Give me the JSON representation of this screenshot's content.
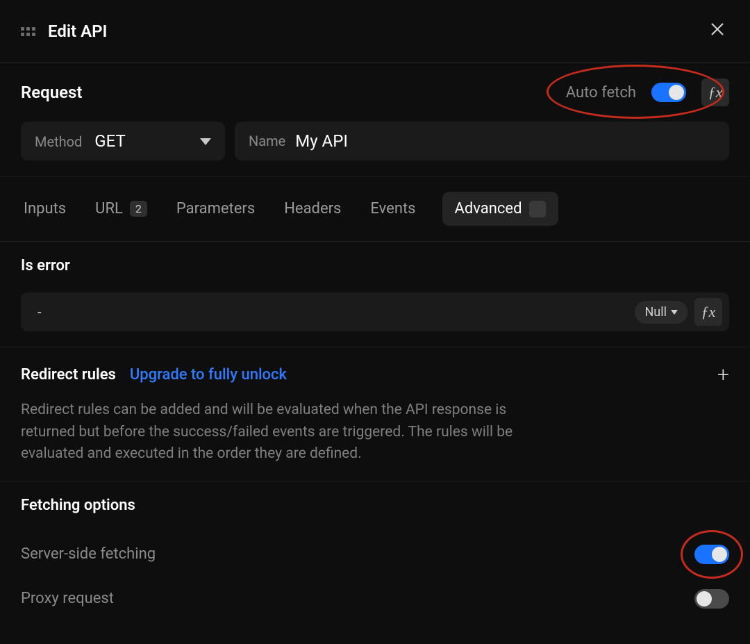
{
  "header": {
    "title": "Edit API"
  },
  "request": {
    "heading": "Request",
    "autofetch_label": "Auto fetch",
    "autofetch_on": true,
    "method_label": "Method",
    "method_value": "GET",
    "name_label": "Name",
    "name_value": "My API"
  },
  "tabs": {
    "items": [
      {
        "label": "Inputs"
      },
      {
        "label": "URL",
        "badge": "2"
      },
      {
        "label": "Parameters"
      },
      {
        "label": "Headers"
      },
      {
        "label": "Events"
      },
      {
        "label": "Advanced",
        "active": true,
        "empty_badge": true
      }
    ]
  },
  "is_error": {
    "heading": "Is error",
    "value": "-",
    "type_chip": "Null"
  },
  "redirect": {
    "heading": "Redirect rules",
    "upgrade_link": "Upgrade to fully unlock",
    "description": "Redirect rules can be added and will be evaluated when the API response is returned but before the success/failed events are triggered. The rules will be evaluated and executed in the order they are defined."
  },
  "fetching": {
    "heading": "Fetching options",
    "server_side_label": "Server-side fetching",
    "server_side_on": true,
    "proxy_label": "Proxy request",
    "proxy_on": false
  },
  "colors": {
    "accent_blue": "#1a73ff",
    "link_blue": "#2f7bff",
    "annotation_red": "#c42b1c"
  }
}
